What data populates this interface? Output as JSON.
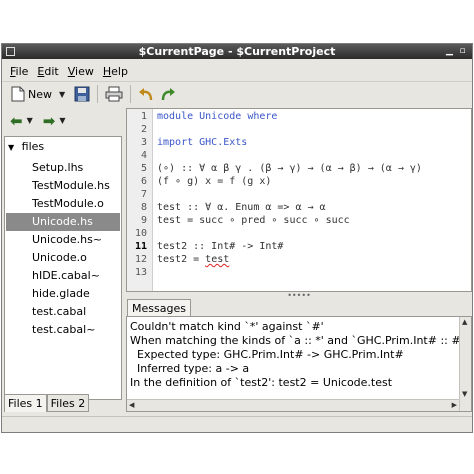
{
  "window": {
    "title": "$CurrentPage - $CurrentProject"
  },
  "menu": [
    {
      "label": "File",
      "mnemonic": "F",
      "rest": "ile"
    },
    {
      "label": "Edit",
      "mnemonic": "E",
      "rest": "dit"
    },
    {
      "label": "View",
      "mnemonic": "V",
      "rest": "iew"
    },
    {
      "label": "Help",
      "mnemonic": "H",
      "rest": "elp"
    }
  ],
  "toolbar": {
    "new_label": "New"
  },
  "tree": {
    "root": "files",
    "items": [
      "Setup.lhs",
      "TestModule.hs",
      "TestModule.o",
      "Unicode.hs",
      "Unicode.hs~",
      "Unicode.o",
      "hIDE.cabal~",
      "hide.glade",
      "test.cabal",
      "test.cabal~"
    ],
    "selected_index": 3
  },
  "left_tabs": [
    "Files 1",
    "Files 2"
  ],
  "editor": {
    "line_numbers": [
      "1",
      "2",
      "3",
      "4",
      "5",
      "6",
      "7",
      "8",
      "9",
      "10",
      "11",
      "12",
      "13"
    ],
    "current_line": "11",
    "lines": {
      "l1_kw1": "module",
      "l1_mod": " Unicode ",
      "l1_kw2": "where",
      "l3_kw": "import",
      "l3_mod": " GHC.Exts",
      "l5": "(∘) :: ∀ α β γ . (β → γ) → (α → β) → (α → γ)",
      "l6": "(f ∘ g) x = f (g x)",
      "l8": "test :: ∀ α. Enum α => α → α",
      "l9": "test = succ ∘ pred ∘ succ ∘ succ",
      "l11": "test2 :: Int# -> Int#",
      "l12_a": "test2 = ",
      "l12_b": "test"
    }
  },
  "messages": {
    "tab_label": "Messages",
    "lines": [
      "Couldn't match kind `*' against `#'",
      "When matching the kinds of `a :: *' and `GHC.Prim.Int# :: #'",
      "  Expected type: GHC.Prim.Int# -> GHC.Prim.Int#",
      "  Inferred type: a -> a",
      "In the definition of `test2': test2 = Unicode.test"
    ]
  },
  "colors": {
    "keyword": "#3a56c8",
    "titlebar": "#2b2b2b",
    "selection": "#8a8a8a",
    "arrow_icon": "#2f6f25"
  }
}
